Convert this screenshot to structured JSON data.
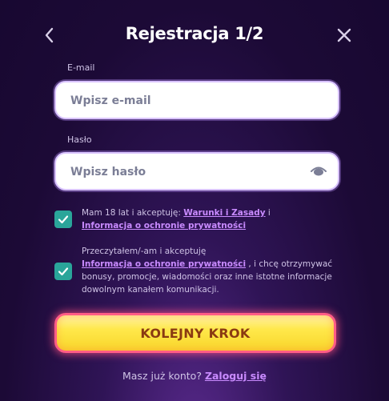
{
  "header": {
    "title": "Rejestracja 1/2",
    "back_icon": "chevron-left-icon",
    "close_icon": "close-icon"
  },
  "email": {
    "label": "E-mail",
    "placeholder": "Wpisz e-mail",
    "value": ""
  },
  "password": {
    "label": "Hasło",
    "placeholder": "Wpisz hasło",
    "value": "",
    "toggle_icon": "eye-icon"
  },
  "consent_terms": {
    "checked": true,
    "text_before": "Mam 18 lat i akceptuję:",
    "link_terms": "Warunki i Zasady",
    "text_mid": "i",
    "link_privacy": "Informacja o ochronie prywatności"
  },
  "consent_marketing": {
    "checked": true,
    "text_before": "Przeczytałem/-am i akceptuję",
    "link_privacy": "Informacja o ochronie prywatności",
    "text_after": ", i chcę otrzymywać bonusy, promocje, wiadomości oraz inne istotne informacje dowolnym kanałem komunikacji."
  },
  "cta": {
    "label": "KOLEJNY KROK"
  },
  "footer": {
    "text": "Masz już konto?",
    "link": "Zaloguj się"
  },
  "colors": {
    "checkbox": "#2aa59a",
    "link": "#c98bff",
    "cta_fill": "#ffe84a",
    "cta_border": "#ff5c86",
    "cta_text": "#8a3a12"
  }
}
